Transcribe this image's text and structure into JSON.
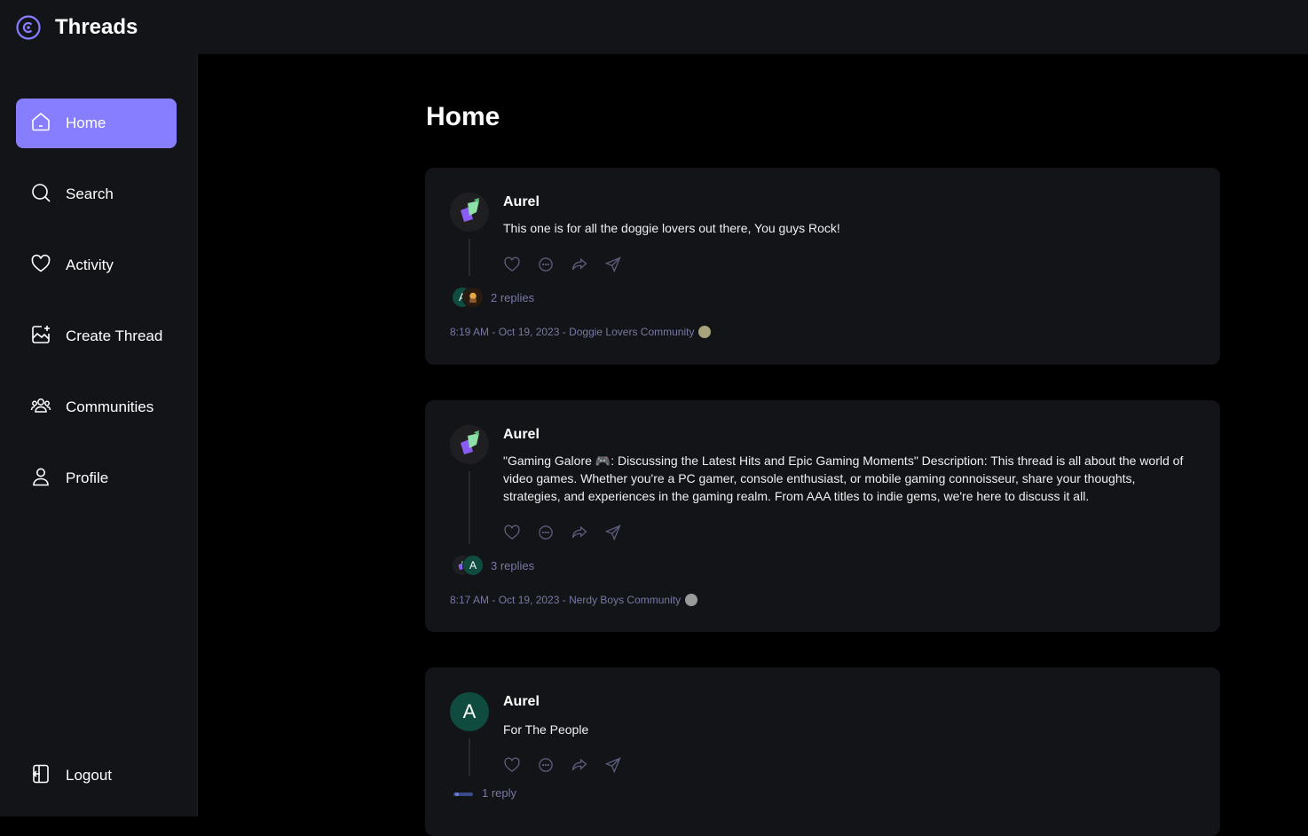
{
  "app": {
    "title": "Threads"
  },
  "sidebar": {
    "items": [
      {
        "label": "Home",
        "icon": "home-icon",
        "active": true
      },
      {
        "label": "Search",
        "icon": "search-icon",
        "active": false
      },
      {
        "label": "Activity",
        "icon": "heart-icon",
        "active": false
      },
      {
        "label": "Create Thread",
        "icon": "create-icon",
        "active": false
      },
      {
        "label": "Communities",
        "icon": "users-icon",
        "active": false
      },
      {
        "label": "Profile",
        "icon": "user-icon",
        "active": false
      }
    ],
    "logout_label": "Logout"
  },
  "colors": {
    "accent": "#877eff",
    "card": "#121417",
    "muted": "#7878a3",
    "background": "#000000"
  },
  "main": {
    "title": "Home",
    "threads": [
      {
        "author": "Aurel",
        "avatar": "image",
        "content": "This one is for all the doggie lovers out there, You guys Rock!",
        "replies": "2 replies",
        "meta": "8:19 AM - Oct 19, 2023 - Doggie Lovers Community"
      },
      {
        "author": "Aurel",
        "avatar": "image",
        "content": "\"Gaming Galore 🎮: Discussing the Latest Hits and Epic Gaming Moments\" Description: This thread is all about the world of video games. Whether you're a PC gamer, console enthusiast, or mobile gaming connoisseur, share your thoughts, strategies, and experiences in the gaming realm. From AAA titles to indie gems, we're here to discuss it all.",
        "replies": "3 replies",
        "meta": "8:17 AM - Oct 19, 2023 - Nerdy Boys Community"
      },
      {
        "author": "Aurel",
        "avatar_letter": "A",
        "content": "For The People",
        "replies": "1 reply"
      }
    ]
  },
  "reply_avatar_letter": "A"
}
